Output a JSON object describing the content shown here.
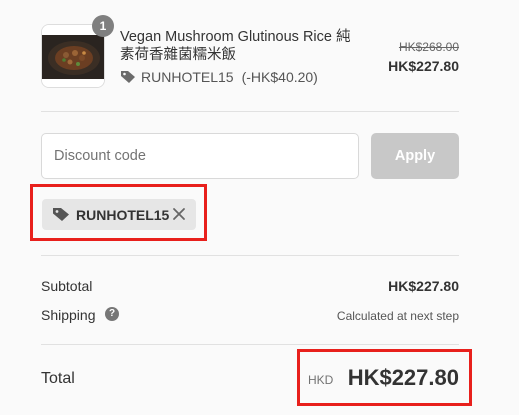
{
  "line_item": {
    "quantity": "1",
    "name": "Vegan Mushroom Glutinous Rice 純素荷香雜菌糯米飯",
    "discount_code": "RUNHOTEL15",
    "discount_amount": "(-HK$40.20)",
    "original_price": "HK$268.00",
    "final_price": "HK$227.80",
    "image": "rice-dish-photo"
  },
  "discount_form": {
    "placeholder": "Discount code",
    "value": "",
    "apply_label": "Apply"
  },
  "applied_tag": {
    "code": "RUNHOTEL15",
    "icon": "tag-icon",
    "remove_icon": "close-icon"
  },
  "summary": {
    "subtotal_label": "Subtotal",
    "subtotal_value": "HK$227.80",
    "shipping_label": "Shipping",
    "shipping_help": "?",
    "shipping_value": "Calculated at next step",
    "total_label": "Total",
    "total_currency": "HKD",
    "total_value": "HK$227.80"
  },
  "colors": {
    "highlight": "#e8201c",
    "apply_disabled": "#c8c8c8",
    "chip_bg": "#e6e6e6"
  }
}
